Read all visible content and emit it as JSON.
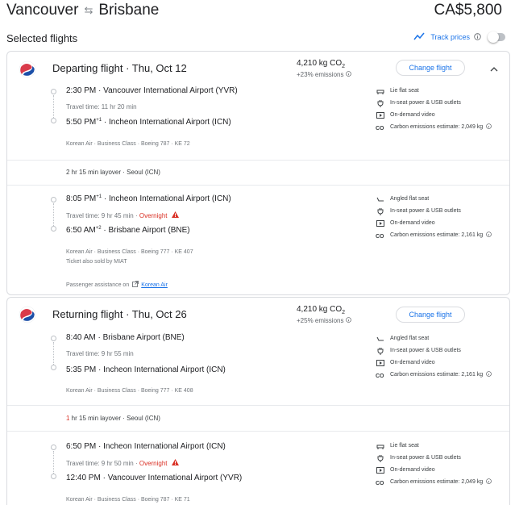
{
  "header": {
    "origin": "Vancouver",
    "destination": "Brisbane",
    "price": "CA$5,800"
  },
  "selected": {
    "label": "Selected flights",
    "track_prices": "Track prices",
    "track_enabled": false
  },
  "departing": {
    "title": "Departing flight",
    "date": "Thu, Oct 12",
    "emissions": "4,210 kg CO",
    "emissions_sub": "2",
    "emissions_pct": "+23% emissions",
    "change_label": "Change flight",
    "legs": [
      {
        "dep_time": "2:30 PM",
        "dep_sup": "",
        "dep_airport": "Vancouver International Airport (YVR)",
        "travel_time": "Travel time: 11 hr 20 min",
        "overnight": "",
        "arr_time": "5:50 PM",
        "arr_sup": "+1",
        "arr_airport": "Incheon International Airport (ICN)",
        "meta": "Korean Air · Business Class · Boeing 787 · KE 72",
        "amenities": [
          "Lie flat seat",
          "In-seat power & USB outlets",
          "On-demand video",
          "Carbon emissions estimate: 2,049 kg"
        ]
      },
      {
        "dep_time": "8:05 PM",
        "dep_sup": "+1",
        "dep_airport": "Incheon International Airport (ICN)",
        "travel_time": "Travel time: 9 hr 45 min",
        "overnight": "Overnight",
        "arr_time": "6:50 AM",
        "arr_sup": "+2",
        "arr_airport": "Brisbane Airport (BNE)",
        "meta": "Korean Air · Business Class · Boeing 777 · KE 407",
        "meta2": "Ticket also sold by MIAT",
        "amenities": [
          "Angled flat seat",
          "In-seat power & USB outlets",
          "On-demand video",
          "Carbon emissions estimate: 2,161 kg"
        ]
      }
    ],
    "layover": "2 hr 15 min layover · Seoul (ICN)",
    "assist_label": "Passenger assistance on",
    "assist_link": "Korean Air"
  },
  "returning": {
    "title": "Returning flight",
    "date": "Thu, Oct 26",
    "emissions": "4,210 kg CO",
    "emissions_sub": "2",
    "emissions_pct": "+25% emissions",
    "change_label": "Change flight",
    "legs": [
      {
        "dep_time": "8:40 AM",
        "dep_airport": "Brisbane Airport (BNE)",
        "travel_time": "Travel time: 9 hr 55 min",
        "arr_time": "5:35 PM",
        "arr_airport": "Incheon International Airport (ICN)",
        "meta": "Korean Air · Business Class · Boeing 777 · KE 408",
        "amenities": [
          "Angled flat seat",
          "In-seat power & USB outlets",
          "On-demand video",
          "Carbon emissions estimate: 2,161 kg"
        ]
      },
      {
        "dep_time": "6:50 PM",
        "dep_airport": "Incheon International Airport (ICN)",
        "travel_time": "Travel time: 9 hr 50 min",
        "overnight": "Overnight",
        "arr_time": "12:40 PM",
        "arr_airport": "Vancouver International Airport (YVR)",
        "meta": "Korean Air · Business Class · Boeing 787 · KE 71",
        "amenities": [
          "Lie flat seat",
          "In-seat power & USB outlets",
          "On-demand video",
          "Carbon emissions estimate: 2,049 kg"
        ]
      }
    ],
    "layover_red": "1",
    "layover_rest": " hr 15 min layover · Seoul (ICN)"
  },
  "colors": {
    "accent": "#1a73e8",
    "warning": "#d93025",
    "border": "#dadce0"
  }
}
